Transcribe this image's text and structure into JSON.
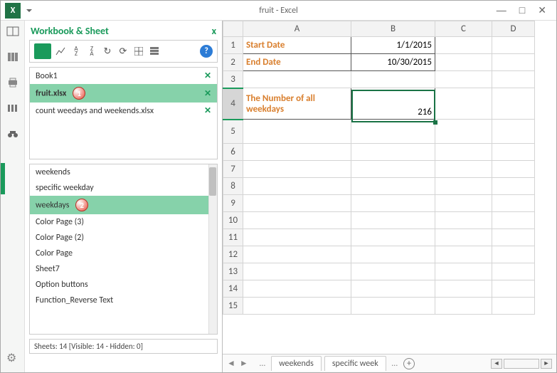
{
  "title": "fruit - Excel",
  "window": {
    "min": "—",
    "max": "□",
    "close": "✕"
  },
  "nav": {
    "title": "Workbook & Sheet",
    "help": "?",
    "close": "x",
    "workbooks": [
      {
        "name": "Book1",
        "selected": false,
        "bold": false
      },
      {
        "name": "fruit.xlsx",
        "selected": true,
        "bold": true
      },
      {
        "name": "count weedays and weekends.xlsx",
        "selected": false,
        "bold": false
      }
    ],
    "sheets": [
      {
        "name": "weekends",
        "selected": false
      },
      {
        "name": "specific weekday",
        "selected": false
      },
      {
        "name": "weekdays",
        "selected": true
      },
      {
        "name": "Color Page (3)",
        "selected": false
      },
      {
        "name": "Color Page (2)",
        "selected": false
      },
      {
        "name": "Color Page",
        "selected": false
      },
      {
        "name": "Sheet7",
        "selected": false
      },
      {
        "name": "Option buttons",
        "selected": false
      },
      {
        "name": "Function_Reverse Text",
        "selected": false
      }
    ],
    "status": "Sheets: 14  [Visible: 14 - Hidden: 0]",
    "callouts": {
      "wb": "1",
      "sh": "2"
    }
  },
  "columns": [
    "A",
    "B",
    "C",
    "D"
  ],
  "rows": [
    "1",
    "2",
    "3",
    "4",
    "5",
    "6",
    "7",
    "8",
    "9",
    "10",
    "11",
    "12",
    "13",
    "14",
    "15"
  ],
  "cells": {
    "A1": "Start Date",
    "B1": "1/1/2015",
    "A2": "End Date",
    "B2": "10/30/2015",
    "A4": "The Number of all weekdays",
    "B4": "216"
  },
  "tabs": {
    "nav_left": "◄",
    "nav_right": "►",
    "items": [
      "weekends",
      "specific week"
    ],
    "ellipsis": "…",
    "plus": "+"
  }
}
